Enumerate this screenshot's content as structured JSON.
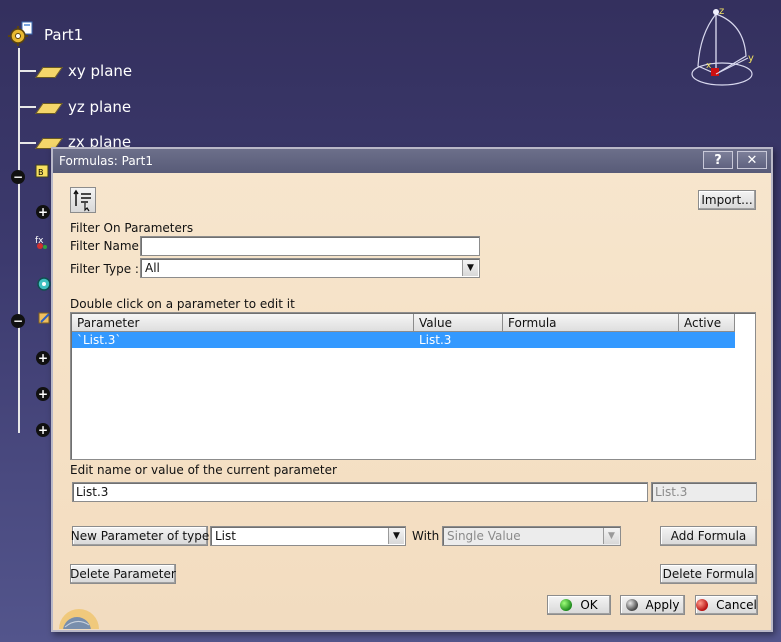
{
  "tree": {
    "root_label": "Part1",
    "items": [
      {
        "label": "xy plane"
      },
      {
        "label": "yz plane"
      },
      {
        "label": "zx plane"
      }
    ]
  },
  "compass": {
    "x_label": "x",
    "y_label": "y",
    "z_label": "z"
  },
  "dialog": {
    "title": "Formulas: Part1",
    "help_label": "?",
    "close_label": "✕",
    "import_label": "Import...",
    "filter_section_label": "Filter On Parameters",
    "filter_name_label": "Filter Name :",
    "filter_name_value": "",
    "filter_type_label": "Filter Type :",
    "filter_type_value": "All",
    "table_caption": "Double click on a parameter to edit it",
    "columns": [
      "Parameter",
      "Value",
      "Formula",
      "Active"
    ],
    "rows": [
      {
        "parameter": "`List.3`",
        "value": "List.3",
        "formula": "",
        "active": ""
      }
    ],
    "edit_caption": "Edit name or value of the current parameter",
    "edit_name_value": "List.3",
    "edit_value_value": "List.3",
    "new_param_label": "New Parameter of type",
    "new_param_type": "List",
    "with_label": "With",
    "with_value": "Single Value",
    "add_formula_label": "Add Formula",
    "delete_parameter_label": "Delete Parameter",
    "delete_formula_label": "Delete Formula",
    "ok_label": "OK",
    "apply_label": "Apply",
    "cancel_label": "Cancel"
  },
  "colors": {
    "background": "#3c3a6e",
    "dialog_bg": "#f5e0c4",
    "selection": "#3399ff",
    "titlebar": "#585b78"
  }
}
